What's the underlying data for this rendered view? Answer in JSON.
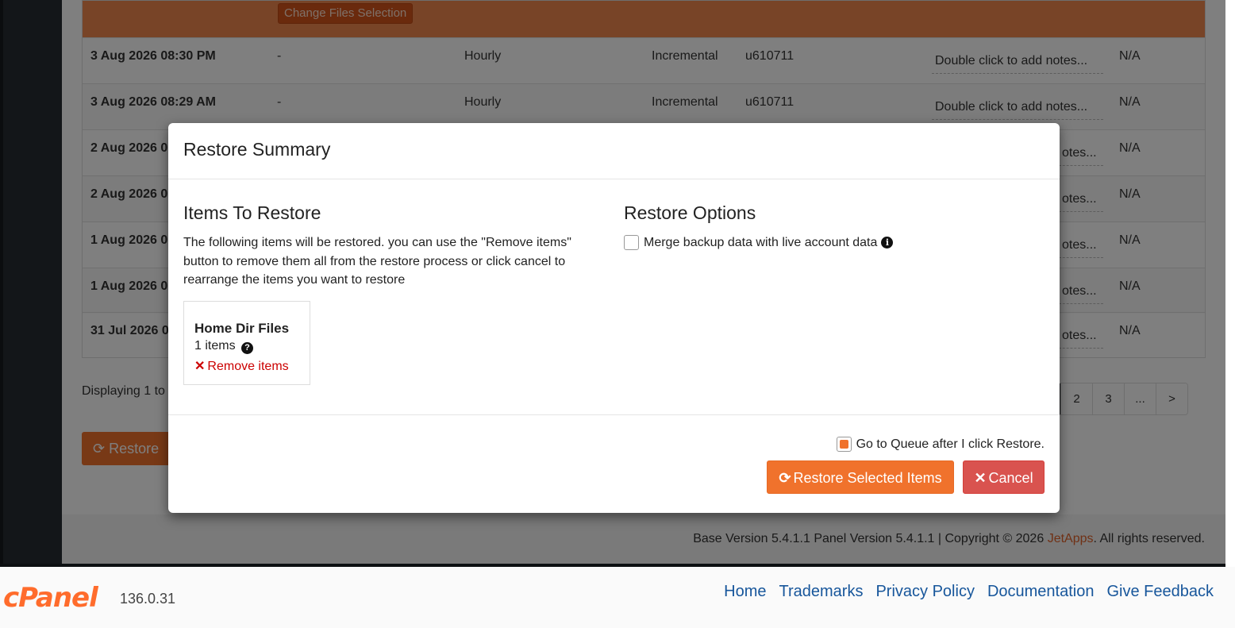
{
  "background": {
    "change_files_label": "Change Files Selection",
    "rows": [
      {
        "date": "3 Aug 2026 08:30 PM",
        "dash": "-",
        "freq": "Hourly",
        "type": "Incremental",
        "user": "u610711",
        "notes": "Double click to add notes...",
        "na": "N/A"
      },
      {
        "date": "3 Aug 2026 08:29 AM",
        "dash": "-",
        "freq": "Hourly",
        "type": "Incremental",
        "user": "u610711",
        "notes": "Double click to add notes...",
        "na": "N/A"
      },
      {
        "date": "2 Aug 2026 0",
        "notes": "otes...",
        "na": "N/A"
      },
      {
        "date": "2 Aug 2026 0",
        "notes": "otes...",
        "na": "N/A"
      },
      {
        "date": "1 Aug 2026 0",
        "notes": "otes...",
        "na": "N/A"
      },
      {
        "date": "1 Aug 2026 0",
        "notes": "otes...",
        "na": "N/A"
      },
      {
        "date": "31 Jul 2026 0",
        "notes": "otes...",
        "na": "N/A"
      }
    ],
    "displaying": "Displaying 1 to",
    "pagination": [
      "",
      "2",
      "3",
      "...",
      ">"
    ],
    "restore_button": "Restore",
    "copyright_prefix": "Base Version 5.4.1.1 Panel Version 5.4.1.1 | Copyright © 2026",
    "copyright_brand": "JetApps",
    "copyright_suffix": ". All rights reserved."
  },
  "modal": {
    "title": "Restore Summary",
    "items_heading": "Items To Restore",
    "items_desc": "The following items will be restored. you can use the \"Remove items\" button to remove them all from the restore process or click cancel to rearrange the items you want to restore",
    "item": {
      "title": "Home Dir Files",
      "count": "1 items",
      "remove": "Remove items"
    },
    "options_heading": "Restore Options",
    "merge_label": "Merge backup data with live account data",
    "merge_checked": false,
    "queue_label": "Go to Queue after I click Restore.",
    "queue_checked": true,
    "restore_btn": "Restore Selected Items",
    "cancel_btn": "Cancel"
  },
  "footer": {
    "logo": "cPanel",
    "version": "136.0.31",
    "links": [
      "Home",
      "Trademarks",
      "Privacy Policy",
      "Documentation",
      "Give Feedback"
    ]
  },
  "colors": {
    "accent": "#f0722c",
    "danger": "#d9534f",
    "link": "#17569b",
    "brand": "#ff6c2c"
  }
}
